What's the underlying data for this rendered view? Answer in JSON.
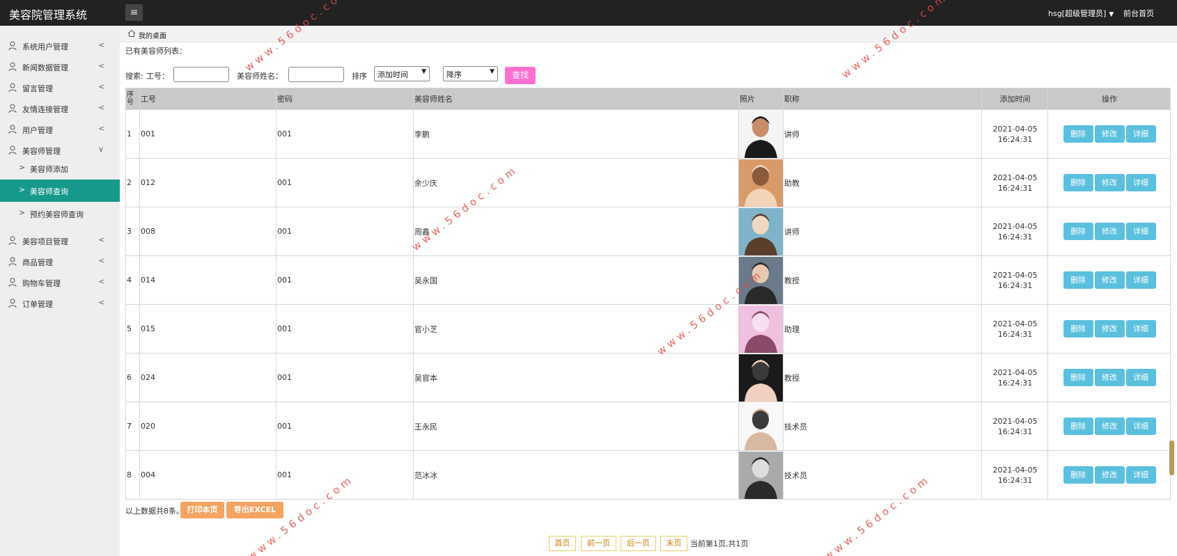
{
  "app": {
    "title": "美容院管理系统",
    "menu_toggle": "≡",
    "user": "hsg[超级管理员]",
    "front_page": "前台首页"
  },
  "sidebar": {
    "items": [
      {
        "label": "系统用户管理",
        "arrow": "<"
      },
      {
        "label": "新闻数据管理",
        "arrow": "<"
      },
      {
        "label": "留言管理",
        "arrow": "<"
      },
      {
        "label": "友情连接管理",
        "arrow": "<"
      },
      {
        "label": "用户管理",
        "arrow": "<"
      },
      {
        "label": "美容师管理",
        "arrow": "∨"
      },
      {
        "label": "美容项目管理",
        "arrow": "<"
      },
      {
        "label": "商品管理",
        "arrow": "<"
      },
      {
        "label": "购物车管理",
        "arrow": "<"
      },
      {
        "label": "订单管理",
        "arrow": "<"
      }
    ],
    "sub_items": [
      {
        "label": "美容师添加"
      },
      {
        "label": "美容师查询"
      },
      {
        "label": "预约美容师查询"
      }
    ]
  },
  "breadcrumb": {
    "label": "我的桌面"
  },
  "list_title": "已有美容师列表：",
  "search": {
    "prefix": "搜索:",
    "gonghao_label": "工号：",
    "name_label": "美容师姓名：",
    "sort_label": "排序",
    "sort_field": "添加时间",
    "sort_order": "降序",
    "find_button": "查找"
  },
  "table": {
    "headers": [
      "序号",
      "工号",
      "密码",
      "美容师姓名",
      "照片",
      "职称",
      "添加时间",
      "操作"
    ],
    "rows": [
      {
        "no": "1",
        "gonghao": "001",
        "password": "001",
        "name": "李鹏",
        "title": "讲师",
        "date": "2021-04-05",
        "time": "16:24:31"
      },
      {
        "no": "2",
        "gonghao": "012",
        "password": "001",
        "name": "余少庆",
        "title": "助教",
        "date": "2021-04-05",
        "time": "16:24:31"
      },
      {
        "no": "3",
        "gonghao": "008",
        "password": "001",
        "name": "周鑫",
        "title": "讲师",
        "date": "2021-04-05",
        "time": "16:24:31"
      },
      {
        "no": "4",
        "gonghao": "014",
        "password": "001",
        "name": "吴永国",
        "title": "教授",
        "date": "2021-04-05",
        "time": "16:24:31"
      },
      {
        "no": "5",
        "gonghao": "015",
        "password": "001",
        "name": "官小芝",
        "title": "助理",
        "date": "2021-04-05",
        "time": "16:24:31"
      },
      {
        "no": "6",
        "gonghao": "024",
        "password": "001",
        "name": "吴官本",
        "title": "教授",
        "date": "2021-04-05",
        "time": "16:24:31"
      },
      {
        "no": "7",
        "gonghao": "020",
        "password": "001",
        "name": "王永民",
        "title": "技术员",
        "date": "2021-04-05",
        "time": "16:24:31"
      },
      {
        "no": "8",
        "gonghao": "004",
        "password": "001",
        "name": "范冰冰",
        "title": "技术员",
        "date": "2021-04-05",
        "time": "16:24:31"
      }
    ],
    "actions": {
      "delete": "删除",
      "edit": "修改",
      "detail": "详细"
    }
  },
  "footer": {
    "count_text": "以上数据共8条。",
    "print_button": "打印本页",
    "export_button": "导出EXCEL"
  },
  "pagination": {
    "first": "首页",
    "prev": "前一页",
    "next": "后一页",
    "last": "末页",
    "info": "当前第1页,共1页"
  },
  "watermark": "www.56doc.com"
}
